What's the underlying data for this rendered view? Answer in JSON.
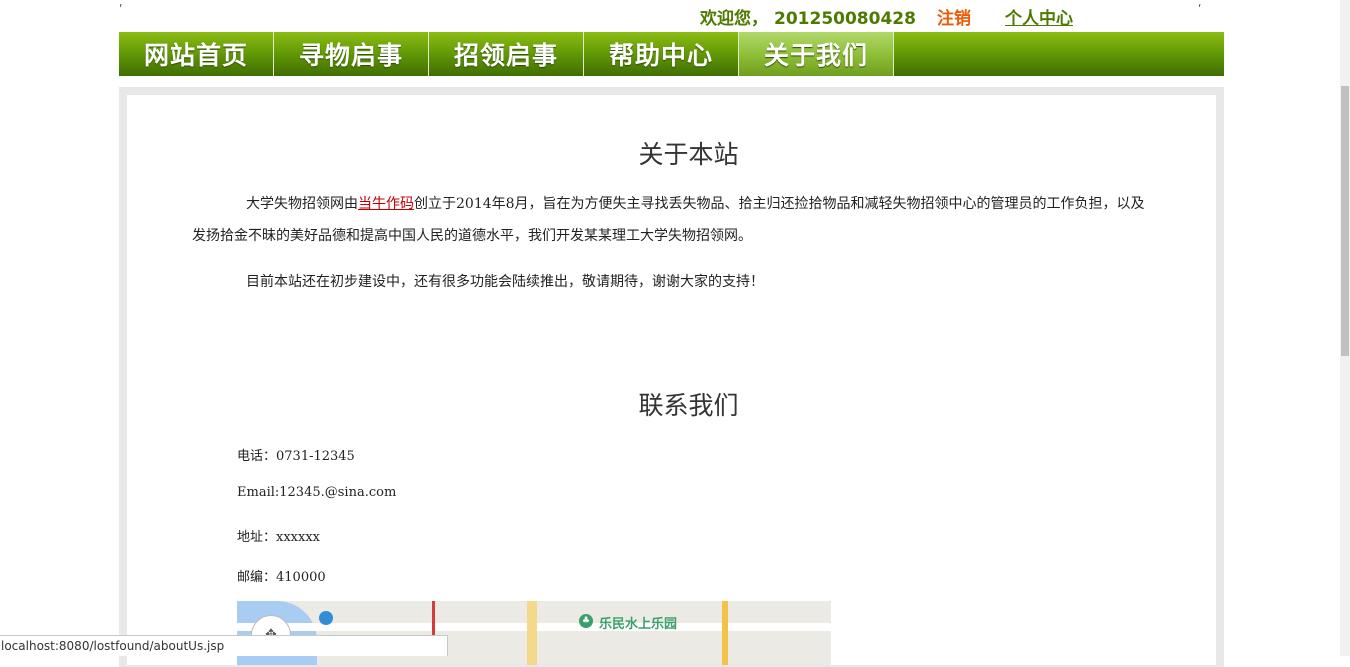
{
  "header": {
    "welcome_label": "欢迎您，",
    "user_id": "201250080428",
    "logout_label": "注销",
    "user_center_label": "个人中心"
  },
  "nav": {
    "items": [
      {
        "label": "网站首页"
      },
      {
        "label": "寻物启事"
      },
      {
        "label": "招领启事"
      },
      {
        "label": "帮助中心"
      },
      {
        "label": "关于我们",
        "active": true
      }
    ]
  },
  "about": {
    "title": "关于本站",
    "para1_before": "大学失物招领网由",
    "para1_link": "当牛作码",
    "para1_after": "创立于2014年8月，旨在为方便失主寻找丢失物品、拾主归还捡拾物品和减轻失物招领中心的管理员的工作负担，以及发扬拾金不昧的美好品德和提高中国人民的道德水平，我们开发某某理工大学失物招领网。",
    "para2": "目前本站还在初步建设中，还有很多功能会陆续推出，敬请期待，谢谢大家的支持！"
  },
  "contact": {
    "title": "联系我们",
    "phone": "电话：0731-12345",
    "email": "Email:12345.@sina.com",
    "address": "地址：xxxxxx",
    "postcode": "邮编：410000"
  },
  "map": {
    "poi_label": "乐民水上乐园"
  },
  "statusbar": {
    "url": "localhost:8080/lostfound/aboutUs.jsp"
  },
  "colors": {
    "nav_green": "#659c06",
    "header_green": "#4e7a00",
    "logout_orange": "#ee5b08",
    "link_red": "#c00000"
  }
}
